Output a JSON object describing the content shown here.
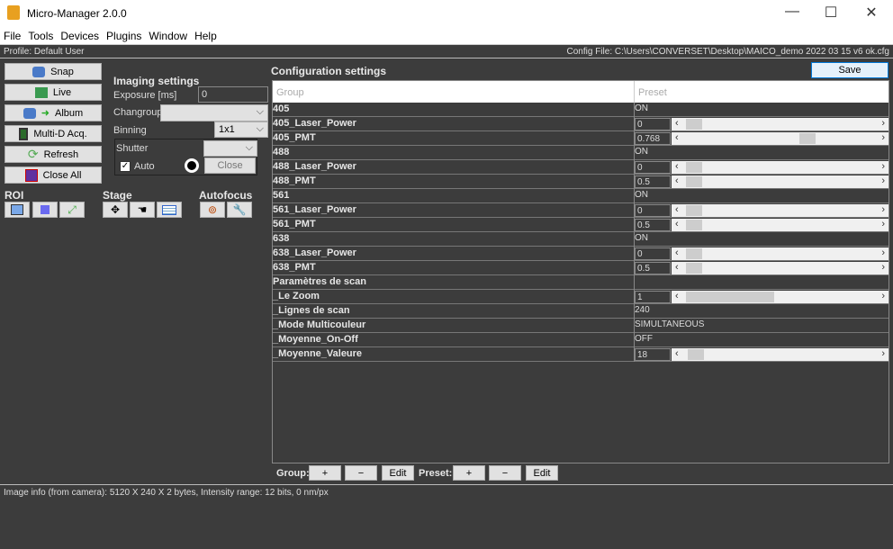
{
  "window": {
    "title": "Micro-Manager 2.0.0",
    "minimize": "—",
    "maximize": "☐",
    "close": "✕"
  },
  "menu": [
    "File",
    "Tools",
    "Devices",
    "Plugins",
    "Window",
    "Help"
  ],
  "profile": "Profile: Default User",
  "config_file": "Config File: C:\\Users\\CONVERSET\\Desktop\\MAICO_demo 2022 03 15 v6 ok.cfg",
  "left_buttons": {
    "snap": "Snap",
    "live": "Live",
    "album": "Album",
    "multid": "Multi-D Acq.",
    "refresh": "Refresh",
    "close_all": "Close All"
  },
  "imaging": {
    "title": "Imaging settings",
    "exposure_label": "Exposure [ms]",
    "exposure_value": "0",
    "changroup_label": "Changroup",
    "changroup_value": "",
    "binning_label": "Binning",
    "binning_value": "1x1",
    "shutter_label": "Shutter",
    "shutter_value": "",
    "auto_label": "Auto",
    "auto_checked": true,
    "close_label": "Close"
  },
  "tools": {
    "roi": "ROI",
    "stage": "Stage",
    "autofocus": "Autofocus"
  },
  "config": {
    "title": "Configuration settings",
    "save": "Save",
    "col_group": "Group",
    "col_preset": "Preset",
    "rows": [
      {
        "group": "405",
        "preset": "ON"
      },
      {
        "group": "405_Laser_Power",
        "value": "0",
        "level": 0
      },
      {
        "group": "405_PMT",
        "value": "0.768",
        "level": 0.66
      },
      {
        "group": "488",
        "preset": "ON"
      },
      {
        "group": "488_Laser_Power",
        "value": "0",
        "level": 0
      },
      {
        "group": "488_PMT",
        "value": "0.5",
        "level": 0
      },
      {
        "group": "561",
        "preset": "ON"
      },
      {
        "group": "561_Laser_Power",
        "value": "0",
        "level": 0
      },
      {
        "group": "561_PMT",
        "value": "0.5",
        "level": 0
      },
      {
        "group": "638",
        "preset": "ON"
      },
      {
        "group": "638_Laser_Power",
        "value": "0",
        "level": 0
      },
      {
        "group": "638_PMT",
        "value": "0.5",
        "level": 0
      },
      {
        "group": "Paramètres de scan",
        "preset": ""
      },
      {
        "group": "_Le Zoom",
        "value": "1",
        "level": 0,
        "extent": 0.47
      },
      {
        "group": "_Lignes de scan",
        "preset": "240"
      },
      {
        "group": "_Mode Multicouleur",
        "preset": "SIMULTANEOUS"
      },
      {
        "group": "_Moyenne_On-Off",
        "preset": "OFF"
      },
      {
        "group": "_Moyenne_Valeure",
        "value": "18",
        "level": 0.01
      }
    ]
  },
  "bottom": {
    "group_label": "Group:",
    "preset_label": "Preset:",
    "plus": "+",
    "minus": "−",
    "edit": "Edit"
  },
  "status": "Image info (from camera): 5120 X 240 X 2 bytes, Intensity range: 12 bits, 0 nm/px"
}
